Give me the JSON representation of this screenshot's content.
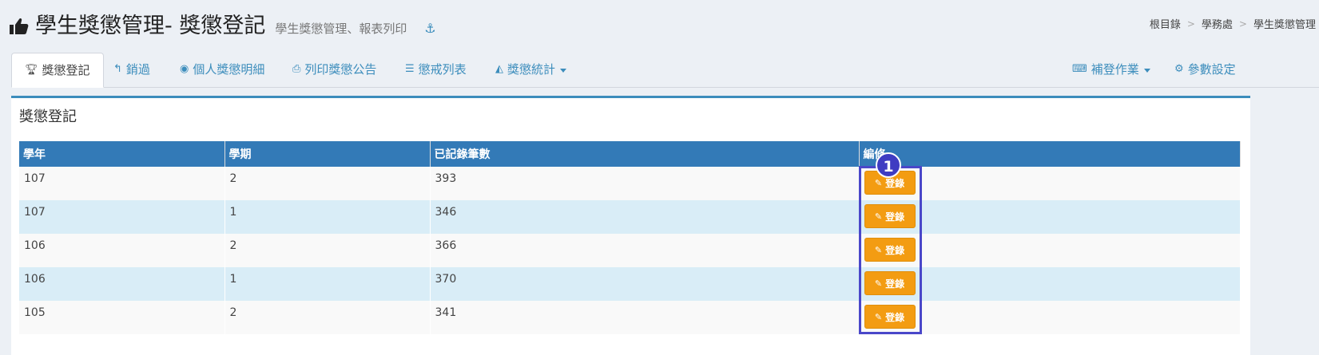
{
  "header": {
    "title": "學生獎懲管理- 獎懲登記",
    "subtitle": "學生獎懲管理、報表列印",
    "breadcrumb": [
      "根目錄",
      "學務處",
      "學生獎懲管理"
    ]
  },
  "tabs": [
    {
      "label": "獎懲登記",
      "icon": "trophy-icon"
    },
    {
      "label": "銷過",
      "icon": "reply-icon"
    },
    {
      "label": "個人獎懲明細",
      "icon": "user-circle-icon"
    },
    {
      "label": "列印獎懲公告",
      "icon": "print-icon"
    },
    {
      "label": "懲戒列表",
      "icon": "list-icon"
    },
    {
      "label": "獎懲統計",
      "icon": "area-chart-icon"
    },
    {
      "label": "補登作業",
      "icon": "keyboard-icon"
    },
    {
      "label": "參數設定",
      "icon": "gear-icon"
    }
  ],
  "panel": {
    "title": "獎懲登記",
    "columns": [
      "學年",
      "學期",
      "已記錄筆數",
      "編修"
    ],
    "rows": [
      {
        "year": "107",
        "term": "2",
        "count": "393",
        "action": "登錄"
      },
      {
        "year": "107",
        "term": "1",
        "count": "346",
        "action": "登錄"
      },
      {
        "year": "106",
        "term": "2",
        "count": "366",
        "action": "登錄"
      },
      {
        "year": "106",
        "term": "1",
        "count": "370",
        "action": "登錄"
      },
      {
        "year": "105",
        "term": "2",
        "count": "341",
        "action": "登錄"
      }
    ]
  },
  "annotation": {
    "marker_label": "1"
  },
  "colors": {
    "primary": "#3c8dbc",
    "table_header": "#337ab7",
    "button": "#f39c12",
    "highlight": "#4a47c9"
  }
}
